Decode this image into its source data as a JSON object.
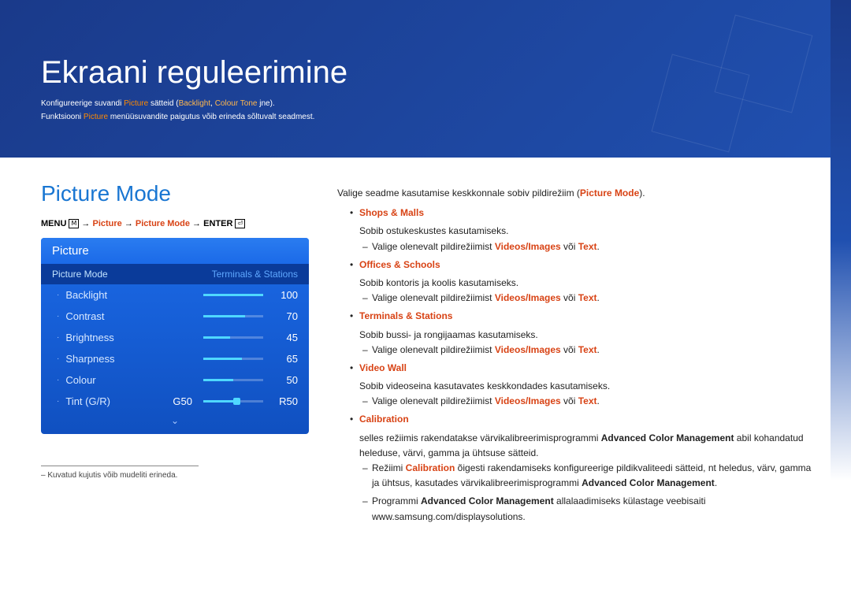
{
  "header": {
    "title": "Ekraani reguleerimine",
    "intro1_pre": "Konfigureerige suvandi ",
    "intro1_hl1": "Picture",
    "intro1_mid": " sätteid (",
    "intro1_hl2": "Backlight",
    "intro1_mid2": ", ",
    "intro1_hl3": "Colour Tone",
    "intro1_post": " jne).",
    "intro2_pre": "Funktsiooni ",
    "intro2_hl": "Picture",
    "intro2_post": " menüüsuvandite paigutus võib erineda sõltuvalt seadmest."
  },
  "left": {
    "section_title": "Picture Mode",
    "path_menu": "MENU",
    "path_arrow": " → ",
    "path_p1": "Picture",
    "path_p2": "Picture Mode",
    "path_enter": "ENTER",
    "menu_icon": "𝖬",
    "enter_icon": "⏎"
  },
  "osd": {
    "title": "Picture",
    "tab_selected": "Picture Mode",
    "tab_unselected": "Terminals & Stations",
    "rows": [
      {
        "label": "Backlight",
        "value": "100",
        "pct": 100
      },
      {
        "label": "Contrast",
        "value": "70",
        "pct": 70
      },
      {
        "label": "Brightness",
        "value": "45",
        "pct": 45
      },
      {
        "label": "Sharpness",
        "value": "65",
        "pct": 65
      },
      {
        "label": "Colour",
        "value": "50",
        "pct": 50
      }
    ],
    "tint": {
      "label": "Tint (G/R)",
      "left": "G50",
      "right": "R50"
    },
    "chevron": "⌄"
  },
  "footnote": "Kuvatud kujutis võib mudeliti erineda.",
  "right": {
    "intro": "Valige seadme kasutamise keskkonnale sobiv pildirežiim (",
    "intro_hl": "Picture Mode",
    "intro_post": ").",
    "items": [
      {
        "name": "Shops & Malls",
        "desc": "Sobib ostukeskustes kasutamiseks."
      },
      {
        "name": "Offices & Schools",
        "desc": "Sobib kontoris ja koolis kasutamiseks."
      },
      {
        "name": "Terminals & Stations",
        "desc": "Sobib bussi- ja rongijaamas kasutamiseks."
      },
      {
        "name": "Video Wall",
        "desc": "Sobib videoseina kasutavates keskkondades kasutamiseks."
      }
    ],
    "sub_pre": "Valige olenevalt pildirežiimist ",
    "sub_hl1": "Videos/Images",
    "sub_mid": " või ",
    "sub_hl2": "Text",
    "sub_post": ".",
    "calib": {
      "name": "Calibration",
      "desc1_pre": "selles režiimis rakendatakse värvikalibreerimisprogrammi ",
      "desc1_b": "Advanced Color Management",
      "desc1_post": " abil kohandatud heleduse, värvi, gamma ja ühtsuse sätteid.",
      "d1_pre": "Režiimi ",
      "d1_hl": "Calibration",
      "d1_mid": " õigesti rakendamiseks konfigureerige pildikvaliteedi sätteid, nt heledus, värv, gamma ja ühtsus, kasutades värvikalibreerimisprogrammi ",
      "d1_b": "Advanced Color Management",
      "d1_post": ".",
      "d2_pre": "Programmi ",
      "d2_b": "Advanced Color Management",
      "d2_post": " allalaadimiseks külastage veebisaiti www.samsung.com/displaysolutions."
    }
  }
}
